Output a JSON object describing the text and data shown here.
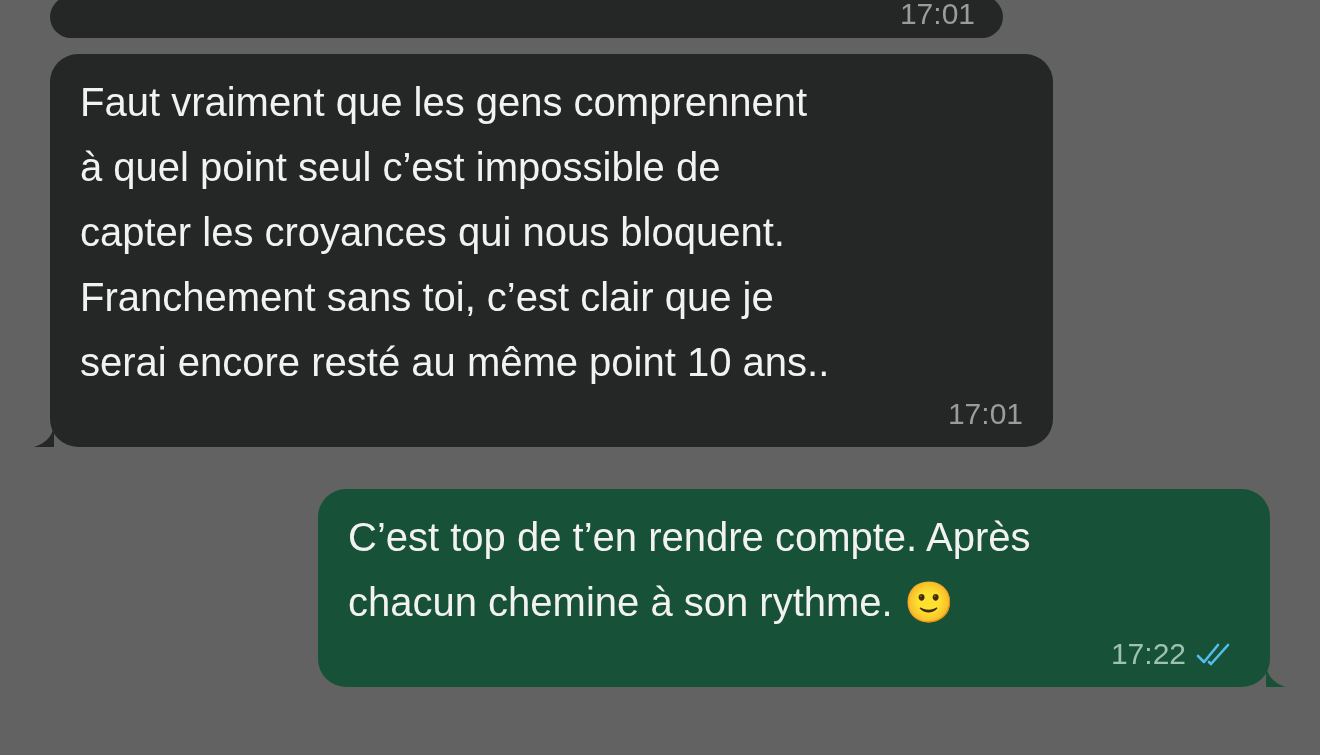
{
  "messages": [
    {
      "kind": "incoming",
      "time": "17:01",
      "tail": false
    },
    {
      "kind": "incoming",
      "text": "Faut vraiment que les gens comprennent\nà quel point seul c’est impossible de\ncapter les croyances qui nous bloquent.\nFranchement sans toi, c’est clair que je\nserai encore resté au même point 10 ans..",
      "time": "17:01",
      "tail": true
    },
    {
      "kind": "outgoing",
      "text": "C’est top de t’en rendre compte. Après\nchacun chemine à son rythme. 🙂",
      "time": "17:22",
      "read": true,
      "tail": true
    }
  ]
}
